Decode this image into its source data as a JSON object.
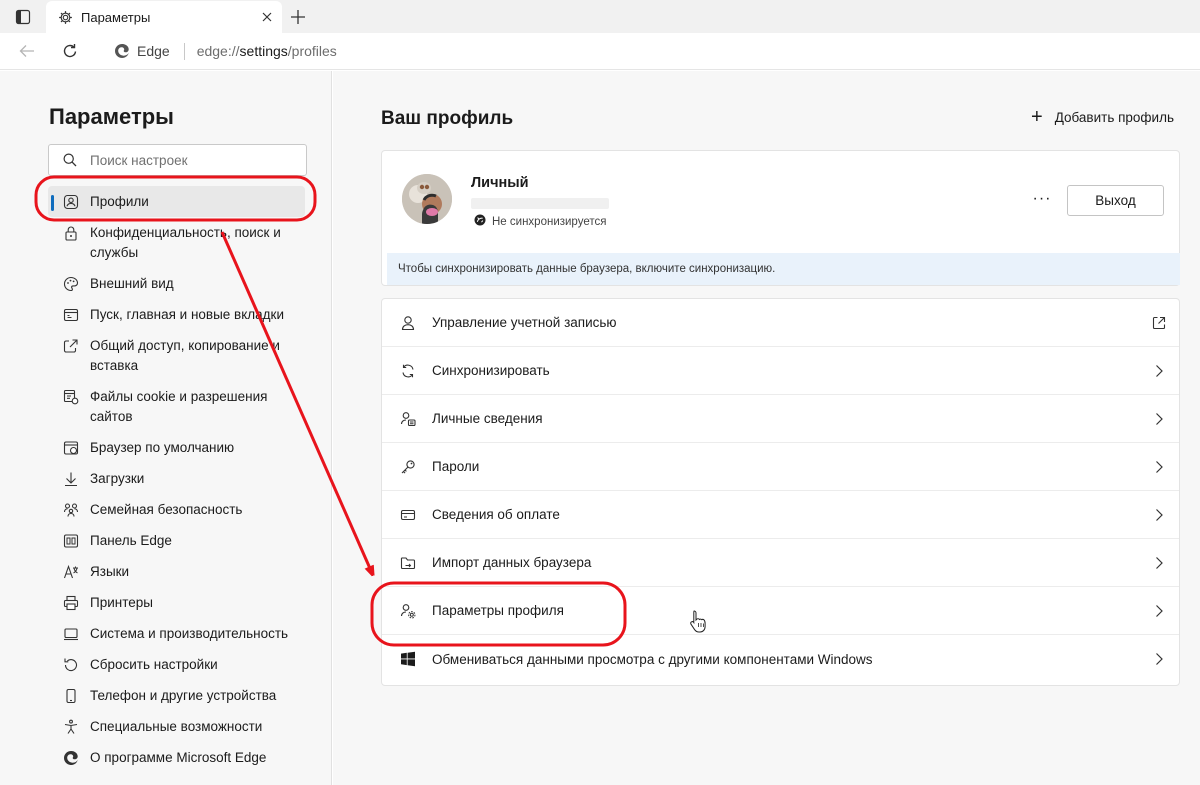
{
  "tab": {
    "title": "Параметры"
  },
  "address": {
    "brand": "Edge",
    "url_prefix": "edge://",
    "url_bold": "settings",
    "url_suffix": "/profiles"
  },
  "sidebar": {
    "title": "Параметры",
    "search_placeholder": "Поиск настроек",
    "items": [
      {
        "label": "Профили",
        "icon": "profile-icon"
      },
      {
        "label": "Конфиденциальность, поиск и службы",
        "icon": "lock-icon"
      },
      {
        "label": "Внешний вид",
        "icon": "palette-icon"
      },
      {
        "label": "Пуск, главная и новые вкладки",
        "icon": "home-tabs-icon"
      },
      {
        "label": "Общий доступ, копирование и вставка",
        "icon": "share-icon"
      },
      {
        "label": "Файлы cookie и разрешения сайтов",
        "icon": "cookie-icon"
      },
      {
        "label": "Браузер по умолчанию",
        "icon": "default-browser-icon"
      },
      {
        "label": "Загрузки",
        "icon": "download-icon"
      },
      {
        "label": "Семейная безопасность",
        "icon": "family-icon"
      },
      {
        "label": "Панель Edge",
        "icon": "edge-bar-icon"
      },
      {
        "label": "Языки",
        "icon": "language-icon"
      },
      {
        "label": "Принтеры",
        "icon": "printer-icon"
      },
      {
        "label": "Система и производительность",
        "icon": "system-icon"
      },
      {
        "label": "Сбросить настройки",
        "icon": "reset-icon"
      },
      {
        "label": "Телефон и другие устройства",
        "icon": "phone-icon"
      },
      {
        "label": "Специальные возможности",
        "icon": "accessibility-icon"
      },
      {
        "label": "О программе Microsoft Edge",
        "icon": "edge-logo-icon"
      }
    ]
  },
  "main": {
    "title": "Ваш профиль",
    "add_profile": "Добавить профиль",
    "profile": {
      "name": "Личный",
      "sync_status": "Не синхронизируется",
      "logout": "Выход",
      "more": "···",
      "banner": "Чтобы синхронизировать данные браузера, включите синхронизацию."
    },
    "menu": [
      {
        "label": "Управление учетной записью",
        "icon": "account-icon",
        "trail": "external-link-icon"
      },
      {
        "label": "Синхронизировать",
        "icon": "sync-icon",
        "trail": "chevron-right-icon"
      },
      {
        "label": "Личные сведения",
        "icon": "personal-info-icon",
        "trail": "chevron-right-icon"
      },
      {
        "label": "Пароли",
        "icon": "key-icon",
        "trail": "chevron-right-icon"
      },
      {
        "label": "Сведения об оплате",
        "icon": "card-icon",
        "trail": "chevron-right-icon"
      },
      {
        "label": "Импорт данных браузера",
        "icon": "import-icon",
        "trail": "chevron-right-icon"
      },
      {
        "label": "Параметры профиля",
        "icon": "profile-settings-icon",
        "trail": "chevron-right-icon"
      },
      {
        "label": "Обмениваться данными просмотра с другими компонентами Windows",
        "icon": "windows-icon",
        "trail": "chevron-right-icon"
      }
    ]
  },
  "annotation": {
    "color": "#e8141c"
  }
}
